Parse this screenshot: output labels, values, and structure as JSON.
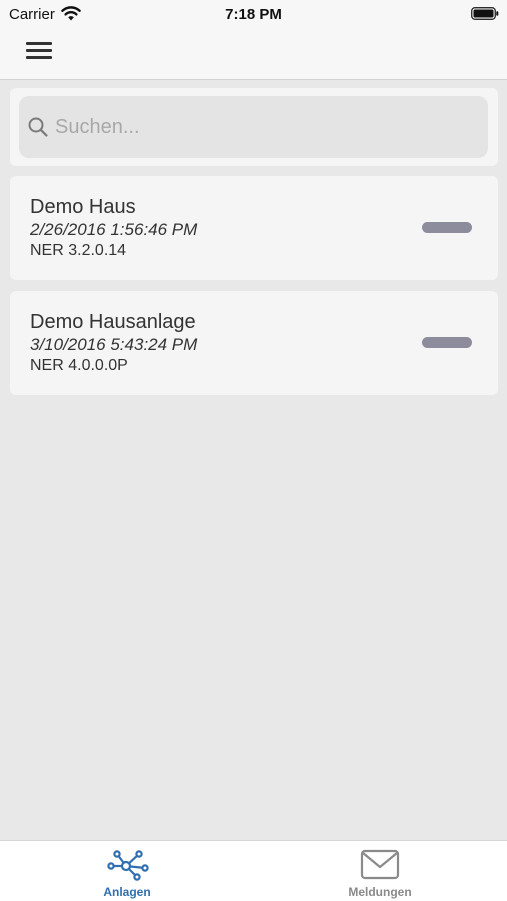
{
  "status_bar": {
    "carrier": "Carrier",
    "time": "7:18 PM",
    "icons": [
      "wifi-icon",
      "battery-icon"
    ]
  },
  "nav": {
    "menu_icon": "hamburger-menu-icon"
  },
  "search": {
    "placeholder": "Suchen...",
    "value": "",
    "icon": "search-icon"
  },
  "items": [
    {
      "title": "Demo Haus",
      "date": "2/26/2016 1:56:46 PM",
      "version": "NER 3.2.0.14"
    },
    {
      "title": "Demo Hausanlage",
      "date": "3/10/2016 5:43:24 PM",
      "version": "NER 4.0.0.0P"
    }
  ],
  "tabs": [
    {
      "label": "Anlagen",
      "icon": "network-nodes-icon",
      "active": true
    },
    {
      "label": "Meldungen",
      "icon": "envelope-icon",
      "active": false
    }
  ],
  "colors": {
    "active_tab": "#2f6fb0",
    "inactive_tab": "#8a8a8a",
    "status_bar_pill": "#8c8c9c",
    "background": "#e8e8e8",
    "card": "#f5f5f5"
  }
}
